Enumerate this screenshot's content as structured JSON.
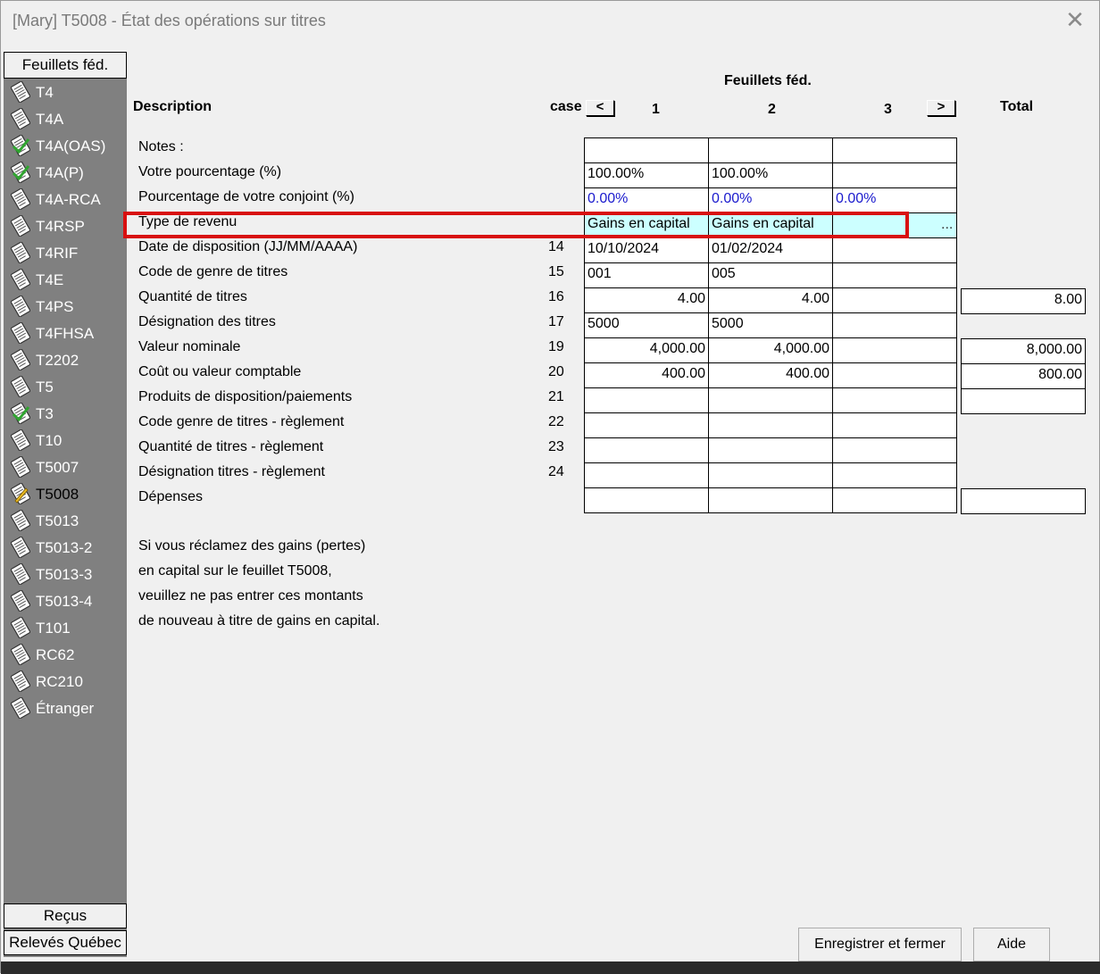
{
  "window": {
    "title": "[Mary] T5008  - État des opérations sur titres"
  },
  "icons": {
    "close": "close-icon",
    "doc": "document-icon",
    "check": "checkmark-icon",
    "pencil": "pencil-icon"
  },
  "sidebar": {
    "header": "Feuillets féd.",
    "items": [
      {
        "label": "T4",
        "mark": ""
      },
      {
        "label": "T4A",
        "mark": ""
      },
      {
        "label": "T4A(OAS)",
        "mark": "check"
      },
      {
        "label": "T4A(P)",
        "mark": "check"
      },
      {
        "label": "T4A-RCA",
        "mark": ""
      },
      {
        "label": "T4RSP",
        "mark": ""
      },
      {
        "label": "T4RIF",
        "mark": ""
      },
      {
        "label": "T4E",
        "mark": ""
      },
      {
        "label": "T4PS",
        "mark": ""
      },
      {
        "label": "T4FHSA",
        "mark": ""
      },
      {
        "label": "T2202",
        "mark": ""
      },
      {
        "label": "T5",
        "mark": ""
      },
      {
        "label": "T3",
        "mark": "check"
      },
      {
        "label": "T10",
        "mark": ""
      },
      {
        "label": "T5007",
        "mark": ""
      },
      {
        "label": "T5008",
        "mark": "pencil"
      },
      {
        "label": "T5013",
        "mark": ""
      },
      {
        "label": "T5013-2",
        "mark": ""
      },
      {
        "label": "T5013-3",
        "mark": ""
      },
      {
        "label": "T5013-4",
        "mark": ""
      },
      {
        "label": "T101",
        "mark": ""
      },
      {
        "label": "RC62",
        "mark": ""
      },
      {
        "label": "RC210",
        "mark": ""
      },
      {
        "label": "Étranger",
        "mark": ""
      }
    ],
    "footer_receipts": "Reçus",
    "footer_quebec": "Relevés Québec"
  },
  "table": {
    "group_header": "Feuillets féd.",
    "col_description": "Description",
    "col_case": "case",
    "nav_prev": "<",
    "nav_next": ">",
    "col_1": "1",
    "col_2": "2",
    "col_3": "3",
    "col_total": "Total",
    "rows": [
      {
        "label": "Notes :",
        "case": "",
        "c1": "",
        "c2": "",
        "c3": "",
        "total": null
      },
      {
        "label": "Votre pourcentage (%)",
        "case": "",
        "c1": "100.00%",
        "c2": "100.00%",
        "c3": "",
        "total": null
      },
      {
        "label": "Pourcentage de votre conjoint (%)",
        "case": "",
        "c1": "0.00%",
        "c2": "0.00%",
        "c3": "0.00%",
        "total": null
      },
      {
        "label": "Type de revenu",
        "case": "",
        "c1": "Gains en capital",
        "c2": "Gains en capital",
        "c3": "",
        "total": null
      },
      {
        "label": "Date de disposition (JJ/MM/AAAA)",
        "case": "14",
        "c1": "10/10/2024",
        "c2": "01/02/2024",
        "c3": "",
        "total": null
      },
      {
        "label": "Code de genre de titres",
        "case": "15",
        "c1": "001",
        "c2": "005",
        "c3": "",
        "total": null
      },
      {
        "label": "Quantité de titres",
        "case": "16",
        "c1": "4.00",
        "c2": "4.00",
        "c3": "",
        "total": "8.00"
      },
      {
        "label": "Désignation des titres",
        "case": "17",
        "c1": "5000",
        "c2": "5000",
        "c3": "",
        "total": null
      },
      {
        "label": "Valeur nominale",
        "case": "19",
        "c1": "4,000.00",
        "c2": "4,000.00",
        "c3": "",
        "total": "8,000.00"
      },
      {
        "label": "Coût ou valeur comptable",
        "case": "20",
        "c1": "400.00",
        "c2": "400.00",
        "c3": "",
        "total": "800.00"
      },
      {
        "label": "Produits de disposition/paiements",
        "case": "21",
        "c1": "",
        "c2": "",
        "c3": "",
        "total": ""
      },
      {
        "label": "Code genre de titres - règlement",
        "case": "22",
        "c1": "",
        "c2": "",
        "c3": "",
        "total": null
      },
      {
        "label": "Quantité de titres - règlement",
        "case": "23",
        "c1": "",
        "c2": "",
        "c3": "",
        "total": null
      },
      {
        "label": "Désignation titres - règlement",
        "case": "24",
        "c1": "",
        "c2": "",
        "c3": "",
        "total": null
      },
      {
        "label": "Dépenses",
        "case": "",
        "c1": "",
        "c2": "",
        "c3": "",
        "total": ""
      }
    ],
    "ellipsis": "..."
  },
  "note": [
    "Si vous réclamez des gains (pertes)",
    "en capital sur le feuillet T5008,",
    "veuillez ne pas entrer ces montants",
    "de nouveau à titre de gains en capital."
  ],
  "buttons": {
    "save_close": "Enregistrer et fermer",
    "help": "Aide"
  },
  "colors": {
    "accent_highlight": "#d81010",
    "blue_value": "#1a1acd",
    "selected_cell": "#ccffff",
    "sidebar_bg": "#808080"
  }
}
